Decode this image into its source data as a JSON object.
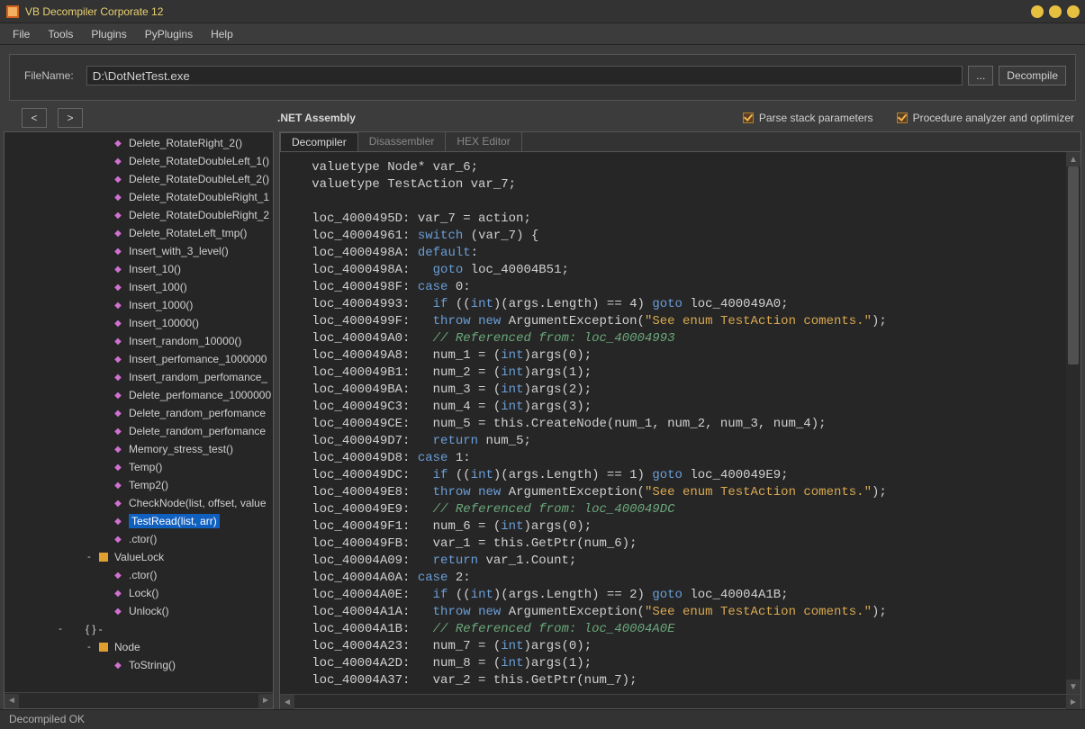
{
  "window": {
    "title": "VB Decompiler Corporate 12"
  },
  "menu": {
    "file": "File",
    "tools": "Tools",
    "plugins": "Plugins",
    "pyplugins": "PyPlugins",
    "help": "Help"
  },
  "file_bar": {
    "label": "FileName:",
    "value": "D:\\DotNetTest.exe",
    "browse": "...",
    "decompile": "Decompile"
  },
  "nav": {
    "back": "<",
    "fwd": ">",
    "asm_label": ".NET Assembly",
    "chk1": "Parse stack parameters",
    "chk2": "Procedure analyzer and optimizer"
  },
  "tree": {
    "items": [
      {
        "level": 3,
        "icon": "method",
        "label": "Delete_RotateRight_2()"
      },
      {
        "level": 3,
        "icon": "method",
        "label": "Delete_RotateDoubleLeft_1()"
      },
      {
        "level": 3,
        "icon": "method",
        "label": "Delete_RotateDoubleLeft_2()"
      },
      {
        "level": 3,
        "icon": "method",
        "label": "Delete_RotateDoubleRight_1"
      },
      {
        "level": 3,
        "icon": "method",
        "label": "Delete_RotateDoubleRight_2"
      },
      {
        "level": 3,
        "icon": "method",
        "label": "Delete_RotateLeft_tmp()"
      },
      {
        "level": 3,
        "icon": "method",
        "label": "Insert_with_3_level()"
      },
      {
        "level": 3,
        "icon": "method",
        "label": "Insert_10()"
      },
      {
        "level": 3,
        "icon": "method",
        "label": "Insert_100()"
      },
      {
        "level": 3,
        "icon": "method",
        "label": "Insert_1000()"
      },
      {
        "level": 3,
        "icon": "method",
        "label": "Insert_10000()"
      },
      {
        "level": 3,
        "icon": "method",
        "label": "Insert_random_10000()"
      },
      {
        "level": 3,
        "icon": "method",
        "label": "Insert_perfomance_1000000"
      },
      {
        "level": 3,
        "icon": "method",
        "label": "Insert_random_perfomance_"
      },
      {
        "level": 3,
        "icon": "method",
        "label": "Delete_perfomance_1000000"
      },
      {
        "level": 3,
        "icon": "method",
        "label": "Delete_random_perfomance"
      },
      {
        "level": 3,
        "icon": "method",
        "label": "Delete_random_perfomance"
      },
      {
        "level": 3,
        "icon": "method",
        "label": "Memory_stress_test()"
      },
      {
        "level": 3,
        "icon": "method",
        "label": "Temp()"
      },
      {
        "level": 3,
        "icon": "method",
        "label": "Temp2()"
      },
      {
        "level": 3,
        "icon": "method",
        "label": "CheckNode(list, offset, value"
      },
      {
        "level": 3,
        "icon": "method",
        "label": "TestRead(list, arr)",
        "selected": true
      },
      {
        "level": 3,
        "icon": "method",
        "label": ".ctor()"
      },
      {
        "level": 2,
        "icon": "class",
        "exp": "-",
        "label": "ValueLock"
      },
      {
        "level": 3,
        "icon": "method",
        "label": ".ctor()"
      },
      {
        "level": 3,
        "icon": "method",
        "label": "Lock()"
      },
      {
        "level": 3,
        "icon": "method",
        "label": "Unlock()"
      },
      {
        "level": 1,
        "icon": "ns",
        "exp": "-",
        "label": "{ }  -"
      },
      {
        "level": 2,
        "icon": "class",
        "exp": "-",
        "label": "Node"
      },
      {
        "level": 3,
        "icon": "method",
        "label": "ToString()"
      }
    ]
  },
  "tabs": {
    "t1": "Decompiler",
    "t2": "Disassembler",
    "t3": "HEX Editor"
  },
  "code": [
    {
      "t": "   valuetype Node* var_6;"
    },
    {
      "t": "   valuetype TestAction var_7;"
    },
    {
      "t": ""
    },
    {
      "a": "loc_4000495D:",
      "b": " var_7 = action;"
    },
    {
      "a": "loc_40004961:",
      "b": " ",
      "kw": "switch",
      "c": " (var_7) {"
    },
    {
      "a": "loc_4000498A:",
      "b": " ",
      "kw": "default",
      "c": ":"
    },
    {
      "a": "loc_4000498A:",
      "b": "   ",
      "kw": "goto",
      "c": " loc_40004B51;"
    },
    {
      "a": "loc_4000498F:",
      "b": " ",
      "kw": "case",
      "c": " 0:"
    },
    {
      "a": "loc_40004993:",
      "b": "   ",
      "kw": "if",
      "c": " ((",
      "kw2": "int",
      "d": ")(args.Length) == 4) ",
      "kw3": "goto",
      "e": " loc_400049A0;"
    },
    {
      "a": "loc_4000499F:",
      "b": "   ",
      "kw": "throw",
      "c": " ",
      "kw2": "new",
      "d": " ArgumentException(",
      "str": "\"See enum TestAction coments.\"",
      "e": ");"
    },
    {
      "a": "loc_400049A0:",
      "b": "   ",
      "cmt": "// Referenced from: loc_40004993"
    },
    {
      "a": "loc_400049A8:",
      "b": "   num_1 = (",
      "kw": "int",
      "c": ")args(0);"
    },
    {
      "a": "loc_400049B1:",
      "b": "   num_2 = (",
      "kw": "int",
      "c": ")args(1);"
    },
    {
      "a": "loc_400049BA:",
      "b": "   num_3 = (",
      "kw": "int",
      "c": ")args(2);"
    },
    {
      "a": "loc_400049C3:",
      "b": "   num_4 = (",
      "kw": "int",
      "c": ")args(3);"
    },
    {
      "a": "loc_400049CE:",
      "b": "   num_5 = this.CreateNode(num_1, num_2, num_3, num_4);"
    },
    {
      "a": "loc_400049D7:",
      "b": "   ",
      "kw": "return",
      "c": " num_5;"
    },
    {
      "a": "loc_400049D8:",
      "b": " ",
      "kw": "case",
      "c": " 1:"
    },
    {
      "a": "loc_400049DC:",
      "b": "   ",
      "kw": "if",
      "c": " ((",
      "kw2": "int",
      "d": ")(args.Length) == 1) ",
      "kw3": "goto",
      "e": " loc_400049E9;"
    },
    {
      "a": "loc_400049E8:",
      "b": "   ",
      "kw": "throw",
      "c": " ",
      "kw2": "new",
      "d": " ArgumentException(",
      "str": "\"See enum TestAction coments.\"",
      "e": ");"
    },
    {
      "a": "loc_400049E9:",
      "b": "   ",
      "cmt": "// Referenced from: loc_400049DC"
    },
    {
      "a": "loc_400049F1:",
      "b": "   num_6 = (",
      "kw": "int",
      "c": ")args(0);"
    },
    {
      "a": "loc_400049FB:",
      "b": "   var_1 = this.GetPtr(num_6);"
    },
    {
      "a": "loc_40004A09:",
      "b": "   ",
      "kw": "return",
      "c": " var_1.Count;"
    },
    {
      "a": "loc_40004A0A:",
      "b": " ",
      "kw": "case",
      "c": " 2:"
    },
    {
      "a": "loc_40004A0E:",
      "b": "   ",
      "kw": "if",
      "c": " ((",
      "kw2": "int",
      "d": ")(args.Length) == 2) ",
      "kw3": "goto",
      "e": " loc_40004A1B;"
    },
    {
      "a": "loc_40004A1A:",
      "b": "   ",
      "kw": "throw",
      "c": " ",
      "kw2": "new",
      "d": " ArgumentException(",
      "str": "\"See enum TestAction coments.\"",
      "e": ");"
    },
    {
      "a": "loc_40004A1B:",
      "b": "   ",
      "cmt": "// Referenced from: loc_40004A0E"
    },
    {
      "a": "loc_40004A23:",
      "b": "   num_7 = (",
      "kw": "int",
      "c": ")args(0);"
    },
    {
      "a": "loc_40004A2D:",
      "b": "   num_8 = (",
      "kw": "int",
      "c": ")args(1);"
    },
    {
      "a": "loc_40004A37:",
      "b": "   var_2 = this.GetPtr(num_7);"
    }
  ],
  "status": {
    "text": "Decompiled OK"
  }
}
